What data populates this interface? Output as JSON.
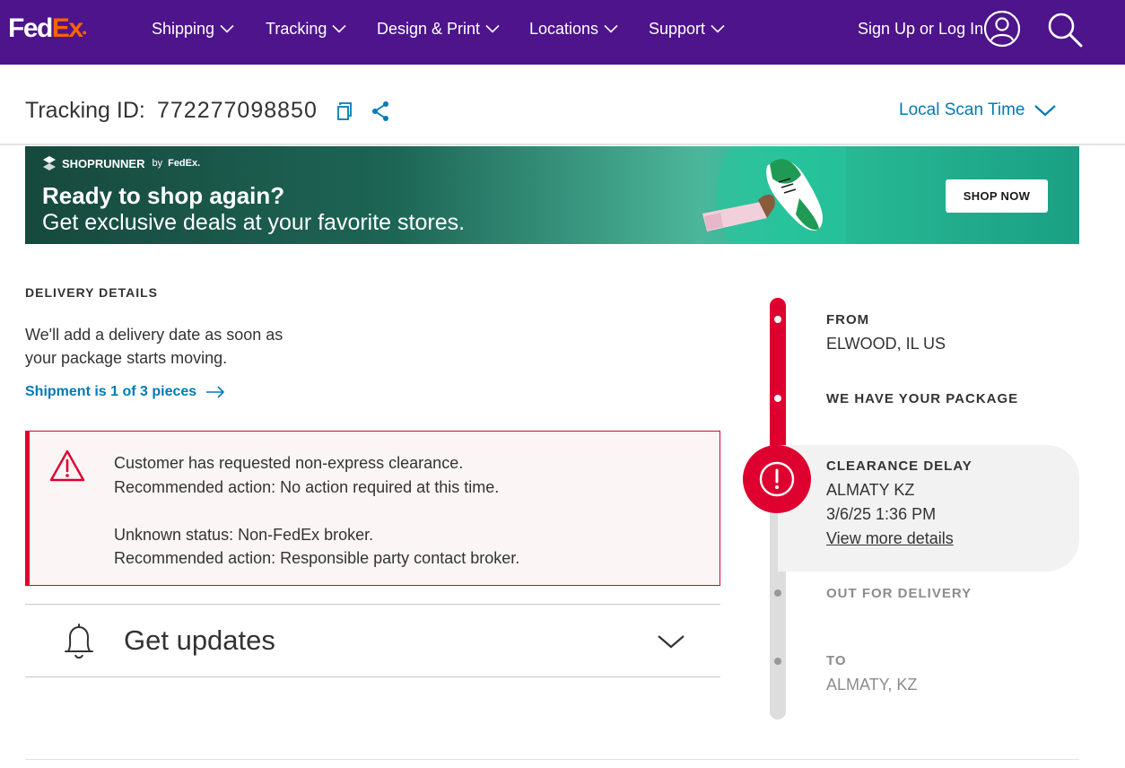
{
  "header": {
    "logo_fed": "Fed",
    "logo_ex": "Ex",
    "nav": [
      {
        "label": "Shipping"
      },
      {
        "label": "Tracking"
      },
      {
        "label": "Design & Print"
      },
      {
        "label": "Locations"
      },
      {
        "label": "Support"
      }
    ],
    "signin_label": "Sign Up or Log In",
    "brand_purple": "#4d148c",
    "brand_orange": "#ff6200"
  },
  "tracking": {
    "label": "Tracking ID:",
    "number": "772277098850",
    "scan_time_label": "Local Scan Time",
    "link_color": "#007ab7"
  },
  "banner": {
    "brand": "SHOPRUNNER",
    "by": "by",
    "by_brand": "FedEx.",
    "headline": "Ready to shop again?",
    "subline": "Get exclusive deals at your favorite stores.",
    "cta": "SHOP NOW"
  },
  "delivery": {
    "title": "DELIVERY DETAILS",
    "line1": "We'll add a delivery date as soon as",
    "line2": "your package starts moving.",
    "shipment_link": "Shipment is 1 of 3 pieces"
  },
  "alert": {
    "line1": "Customer has requested non-express clearance.",
    "line2": "Recommended action: No action required at this time.",
    "line3": "Unknown status: Non-FedEx broker.",
    "line4": "Recommended action: Responsible party contact broker.",
    "color": "#de002e"
  },
  "updates": {
    "label": "Get updates"
  },
  "timeline": {
    "from_label": "FROM",
    "from_value": "ELWOOD, IL US",
    "picked_label": "WE HAVE YOUR PACKAGE",
    "current_label": "CLEARANCE DELAY",
    "current_location": "ALMATY KZ",
    "current_datetime": "3/6/25 1:36 PM",
    "current_link": "View more details",
    "ofd_label": "OUT FOR DELIVERY",
    "to_label": "TO",
    "to_value": "ALMATY, KZ"
  }
}
